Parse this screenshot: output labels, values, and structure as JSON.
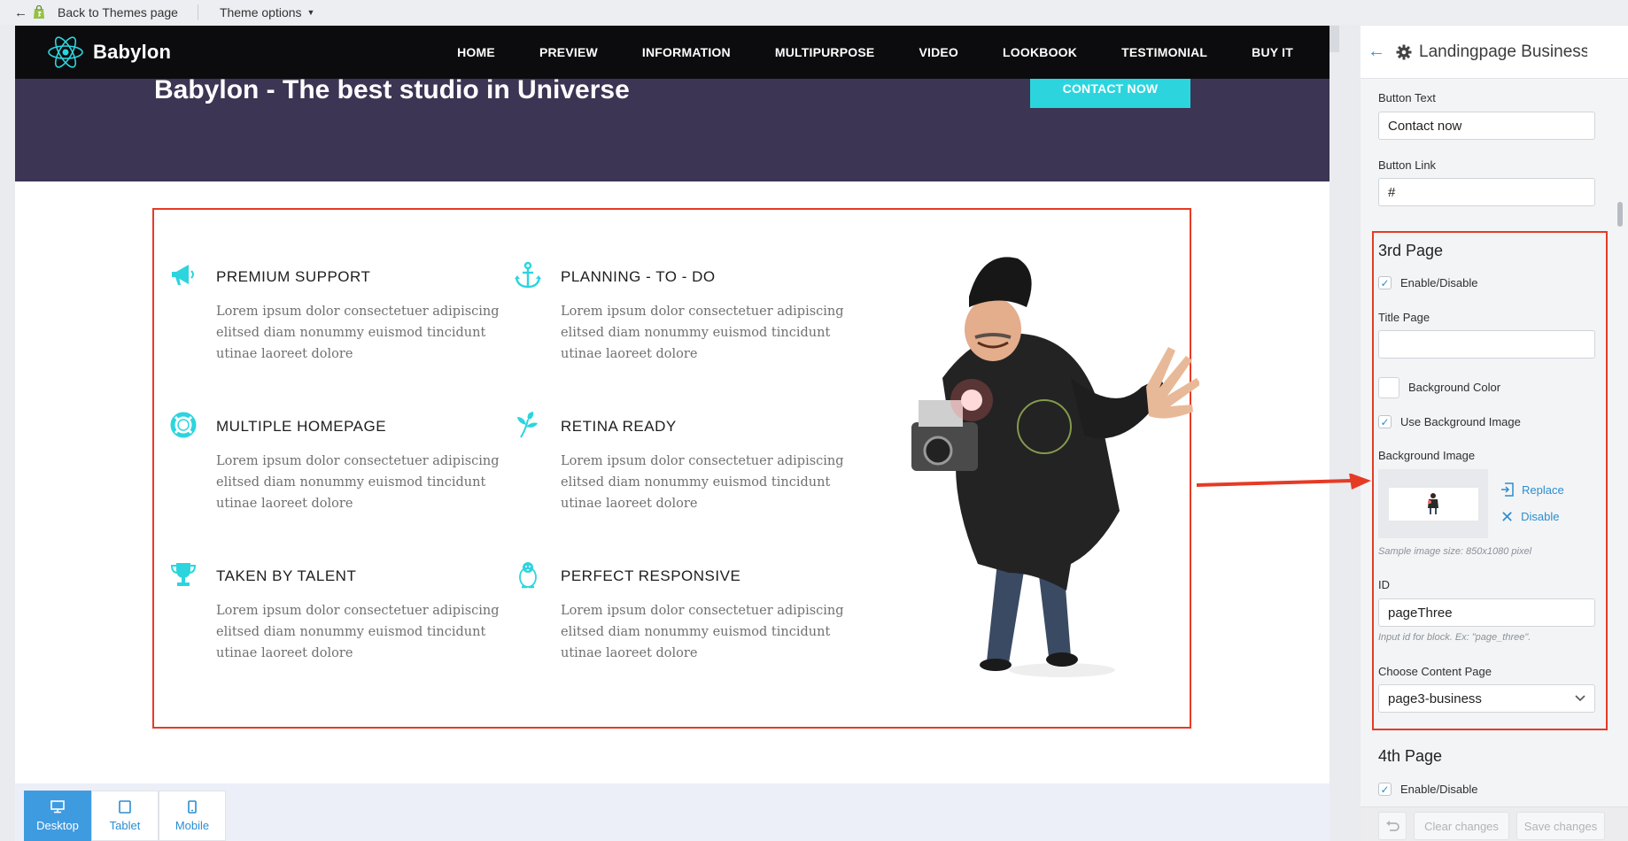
{
  "topbar": {
    "back_label": "Back to Themes page",
    "theme_options_label": "Theme options"
  },
  "site": {
    "logo_text": "Babylon",
    "nav": [
      "HOME",
      "PREVIEW",
      "INFORMATION",
      "MULTIPURPOSE",
      "VIDEO",
      "LOOKBOOK",
      "TESTIMONIAL",
      "BUY IT"
    ],
    "hero_title": "Babylon - The best studio in Universe",
    "cta_label": "CONTACT NOW",
    "features": [
      {
        "icon": "megaphone-icon",
        "title": "PREMIUM SUPPORT",
        "body": "Lorem ipsum dolor consectetuer adipiscing elitsed diam nonummy euismod tincidunt utinae laoreet dolore"
      },
      {
        "icon": "anchor-icon",
        "title": "PLANNING - TO - DO",
        "body": "Lorem ipsum dolor consectetuer adipiscing elitsed diam nonummy euismod tincidunt utinae laoreet dolore"
      },
      {
        "icon": "lifebuoy-icon",
        "title": "MULTIPLE HOMEPAGE",
        "body": "Lorem ipsum dolor consectetuer adipiscing elitsed diam nonummy euismod tincidunt utinae laoreet dolore"
      },
      {
        "icon": "leaf-icon",
        "title": "RETINA READY",
        "body": "Lorem ipsum dolor consectetuer adipiscing elitsed diam nonummy euismod tincidunt utinae laoreet dolore"
      },
      {
        "icon": "trophy-icon",
        "title": "TAKEN BY TALENT",
        "body": "Lorem ipsum dolor consectetuer adipiscing elitsed diam nonummy euismod tincidunt utinae laoreet dolore"
      },
      {
        "icon": "penguin-icon",
        "title": "PERFECT RESPONSIVE",
        "body": "Lorem ipsum dolor consectetuer adipiscing elitsed diam nonummy euismod tincidunt utinae laoreet dolore"
      }
    ]
  },
  "devices": {
    "desktop": "Desktop",
    "tablet": "Tablet",
    "mobile": "Mobile",
    "active": "desktop"
  },
  "panel": {
    "title": "Landingpage Business",
    "button_text_label": "Button Text",
    "button_text_value": "Contact now",
    "button_link_label": "Button Link",
    "button_link_value": "#",
    "page3": {
      "heading": "3rd Page",
      "enable_label": "Enable/Disable",
      "enable_checked": true,
      "title_page_label": "Title Page",
      "title_page_value": "",
      "bg_color_label": "Background Color",
      "use_bg_image_label": "Use Background Image",
      "use_bg_image_checked": true,
      "bg_image_label": "Background Image",
      "replace_label": "Replace",
      "disable_label": "Disable",
      "sample_hint": "Sample image size: 850x1080 pixel",
      "id_label": "ID",
      "id_value": "pageThree",
      "id_hint": "Input id for block. Ex: \"page_three\".",
      "content_page_label": "Choose Content Page",
      "content_page_value": "page3-business"
    },
    "page4": {
      "heading": "4th Page",
      "enable_label": "Enable/Disable",
      "enable_checked": true
    },
    "footer": {
      "clear_label": "Clear changes",
      "save_label": "Save changes"
    }
  },
  "colors": {
    "accent_cyan": "#2cd5de",
    "hero_bg": "#3c3554",
    "nav_bg": "#0c0c0e",
    "highlight_red": "#e53b25",
    "link_blue": "#2b8ed1"
  }
}
